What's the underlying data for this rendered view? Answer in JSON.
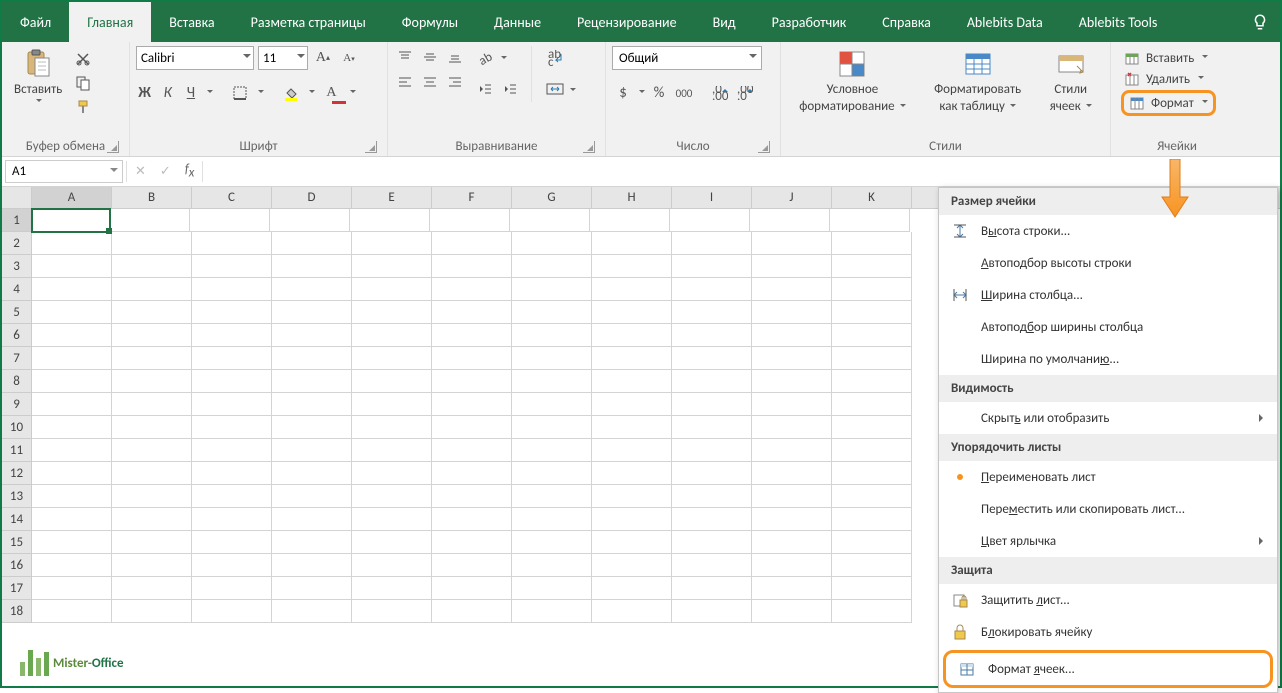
{
  "tabs": [
    "Файл",
    "Главная",
    "Вставка",
    "Разметка страницы",
    "Формулы",
    "Данные",
    "Рецензирование",
    "Вид",
    "Разработчик",
    "Справка",
    "Ablebits Data",
    "Ablebits Tools"
  ],
  "activeTab": 1,
  "ribbon": {
    "clipboard": {
      "paste": "Вставить",
      "label": "Буфер обмена"
    },
    "font": {
      "name": "Calibri",
      "size": "11",
      "bold": "Ж",
      "italic": "К",
      "underline": "Ч",
      "label": "Шрифт"
    },
    "alignment": {
      "wrap": "Переносить текст",
      "merge": "Объединить",
      "label": "Выравнивание"
    },
    "number": {
      "format": "Общий",
      "label": "Число"
    },
    "styles": {
      "conditional": "Условное",
      "conditional2": "форматирование",
      "asTable": "Форматировать",
      "asTable2": "как таблицу",
      "cellStyles": "Стили",
      "cellStyles2": "ячеек",
      "label": "Стили"
    },
    "cells": {
      "insert": "Вставить",
      "delete": "Удалить",
      "format": "Формат",
      "label": "Ячейки"
    }
  },
  "namebox": "A1",
  "columns": [
    "A",
    "B",
    "C",
    "D",
    "E",
    "F",
    "G",
    "H",
    "I",
    "J",
    "K"
  ],
  "rows": [
    "1",
    "2",
    "3",
    "4",
    "5",
    "6",
    "7",
    "8",
    "9",
    "10",
    "11",
    "12",
    "13",
    "14",
    "15",
    "16",
    "17",
    "18"
  ],
  "dropdown": {
    "sec1": "Размер ячейки",
    "rowHeight": "Высота строки...",
    "autoRowHeight": "Автоподбор высоты строки",
    "colWidth": "Ширина столбца...",
    "autoColWidth": "Автоподбор ширины столбца",
    "defaultWidth": "Ширина по умолчанию...",
    "sec2": "Видимость",
    "hideShow": "Скрыть или отобразить",
    "sec3": "Упорядочить листы",
    "rename": "Переименовать лист",
    "moveCopy": "Переместить или скопировать лист...",
    "tabColor": "Цвет ярлычка",
    "sec4": "Защита",
    "protectSheet": "Защитить лист...",
    "lockCell": "Блокировать ячейку",
    "formatCells": "Формат ячеек..."
  },
  "watermark": {
    "p1": "Mister-",
    "p2": "Office"
  }
}
